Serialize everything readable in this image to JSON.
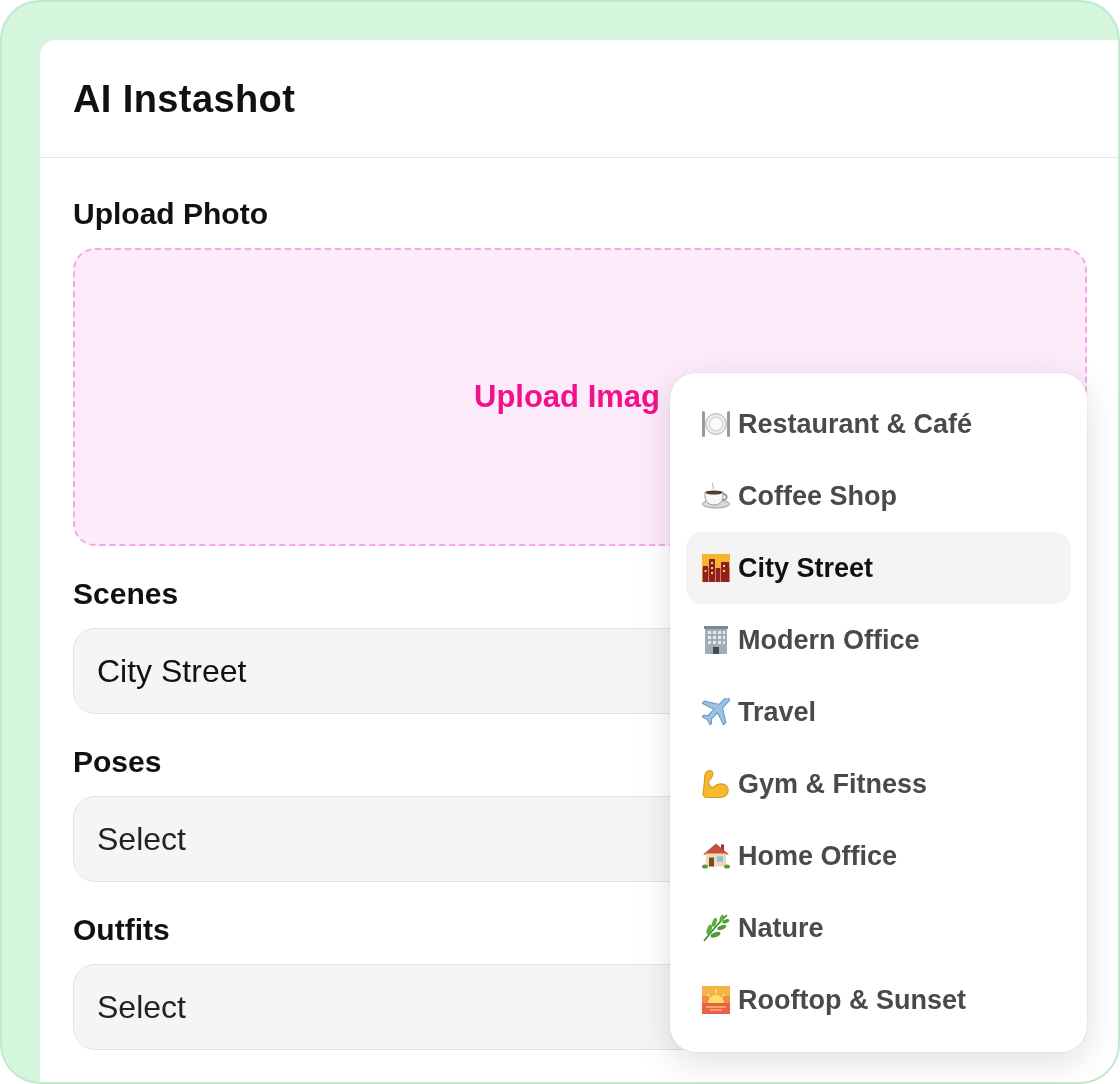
{
  "window": {
    "title": "AI Instashot"
  },
  "upload": {
    "label": "Upload Photo",
    "button": "Upload Imag"
  },
  "fields": [
    {
      "label": "Scenes",
      "value": "City Street"
    },
    {
      "label": "Poses",
      "placeholder": "Select"
    },
    {
      "label": "Outfits",
      "placeholder": "Select"
    }
  ],
  "scenes_dropdown": {
    "items": [
      {
        "label": "Restaurant & Café",
        "selected": false
      },
      {
        "label": "Coffee Shop",
        "selected": false
      },
      {
        "label": "City Street",
        "selected": true
      },
      {
        "label": "Modern Office",
        "selected": false
      },
      {
        "label": "Travel",
        "selected": false
      },
      {
        "label": "Gym & Fitness",
        "selected": false
      },
      {
        "label": "Home Office",
        "selected": false
      },
      {
        "label": "Nature",
        "selected": false
      },
      {
        "label": "Rooftop & Sunset",
        "selected": false
      }
    ]
  }
}
